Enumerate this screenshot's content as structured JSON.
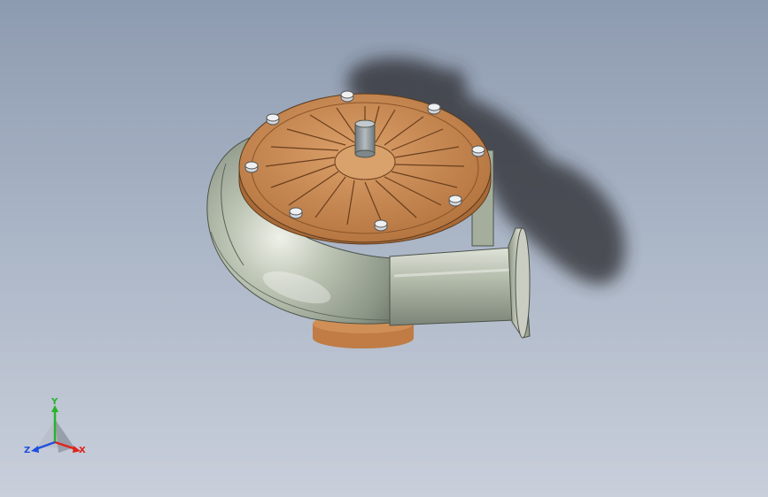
{
  "viewport": {
    "background_top": "#8d9bb0",
    "background_bottom": "#c9cfdb"
  },
  "model": {
    "housing_color": "#a8b29f",
    "cover_color": "#c8834c",
    "bolt_color": "#d4d7db",
    "shaft_color": "#8a9498"
  },
  "triad": {
    "x_label": "X",
    "y_label": "Y",
    "z_label": "Z",
    "x_color": "#e0241b",
    "y_color": "#27b52a",
    "z_color": "#1f4fe0"
  }
}
